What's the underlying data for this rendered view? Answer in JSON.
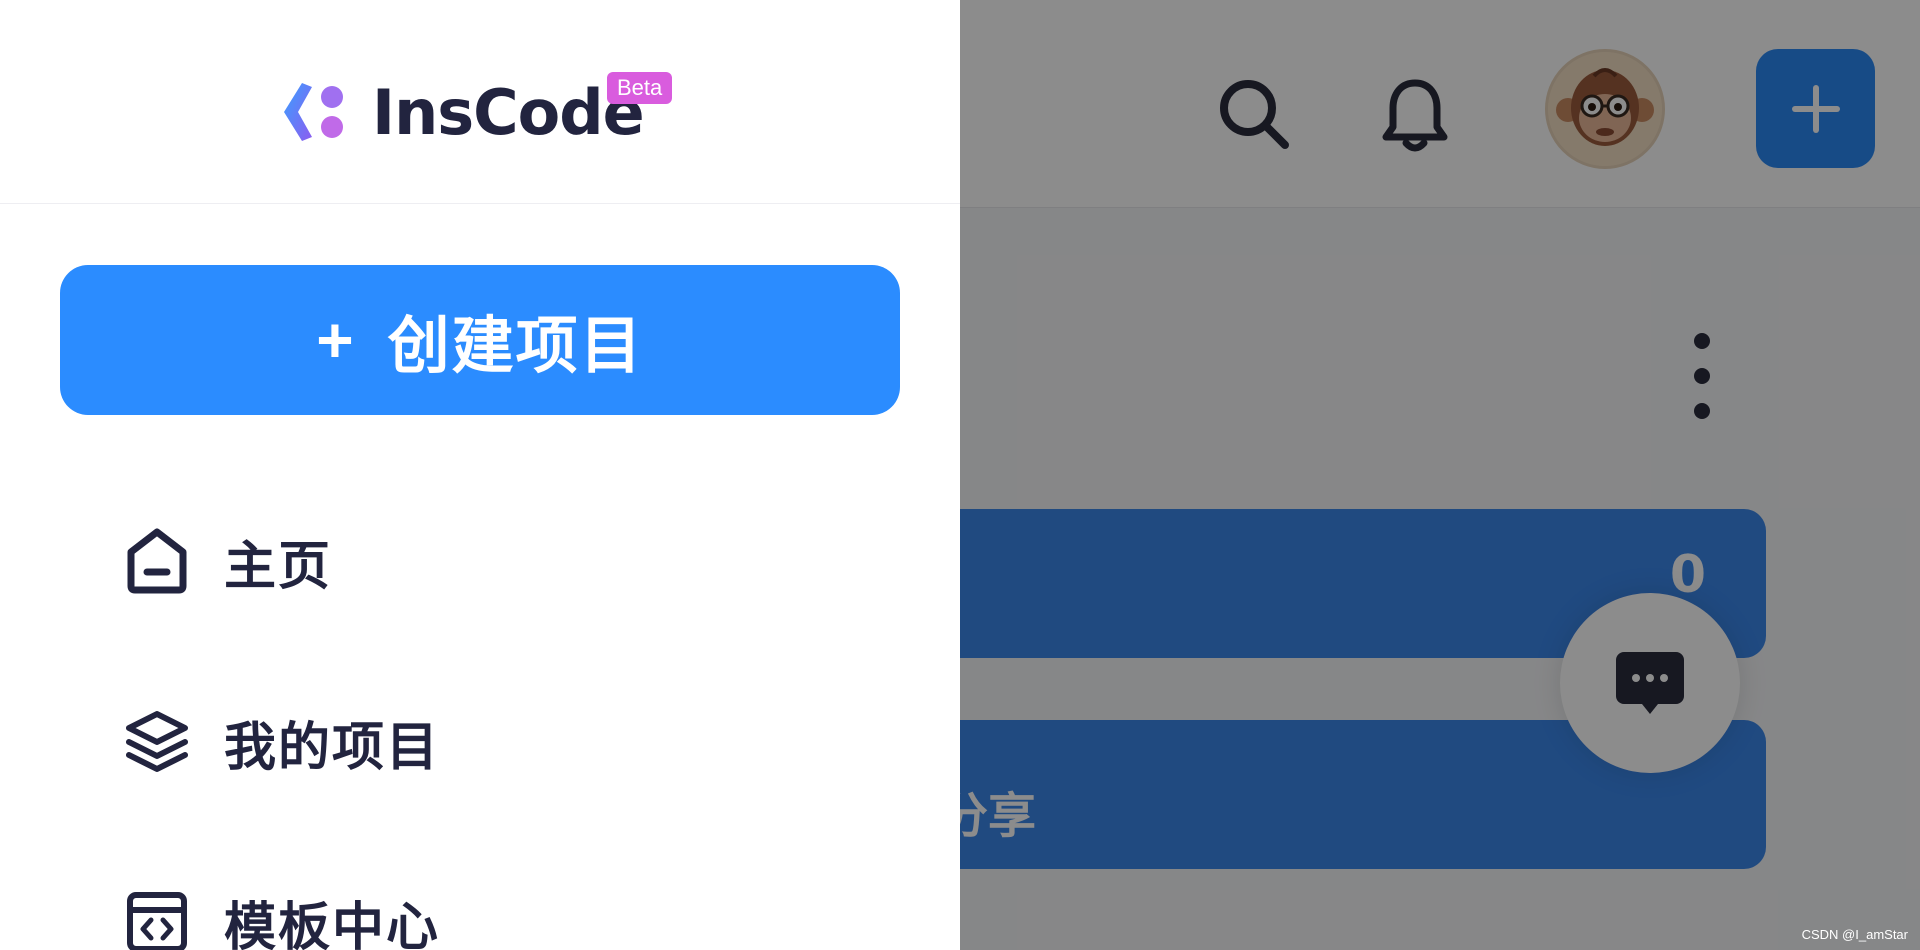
{
  "app": {
    "logo_text": "InsCode",
    "badge": "Beta"
  },
  "drawer": {
    "create_button": {
      "icon": "plus-icon",
      "label": "创建项目"
    },
    "nav_items": [
      {
        "icon": "home-icon",
        "label": "主页"
      },
      {
        "icon": "layers-icon",
        "label": "我的项目"
      },
      {
        "icon": "template-code-icon",
        "label": "模板中心"
      }
    ]
  },
  "background": {
    "header_icons": [
      "search-icon",
      "bell-icon",
      "avatar",
      "plus-icon"
    ],
    "header_plus_label": "+",
    "cards": [
      {
        "label_fragment": "",
        "value": "0"
      },
      {
        "label_fragment": "分享",
        "value": ""
      }
    ]
  },
  "colors": {
    "primary": "#2b8cff",
    "text_dark": "#22243f",
    "badge": "#d95cde",
    "overlay": "rgba(0,0,0,0.45)"
  },
  "watermark": "CSDN @I_amStar"
}
